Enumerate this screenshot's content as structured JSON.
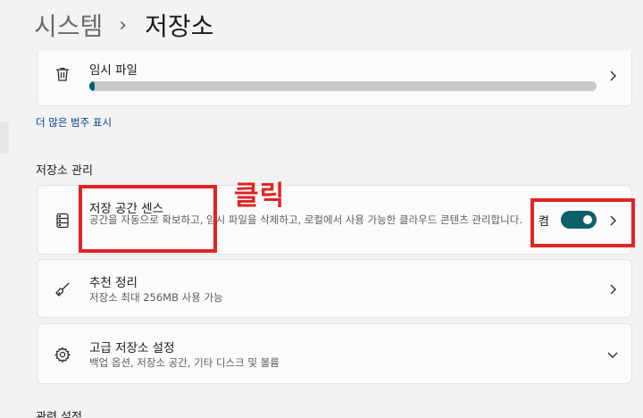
{
  "breadcrumb": {
    "parent": "시스템",
    "separator": "›",
    "current": "저장소"
  },
  "temp_files": {
    "title": "임시 파일",
    "usage_fraction": 0.01
  },
  "show_more_link": "더 많은 범주 표시",
  "management_section": {
    "title": "저장소 관리",
    "storage_sense": {
      "title": "저장 공간 센스",
      "description": "공간을 자동으로 확보하고, 임시 파일을 삭제하고, 로컬에서 사용 가능한 클라우드 콘텐츠 관리합니다.",
      "toggle_label": "켬",
      "toggle_on": true
    },
    "cleanup_recommendations": {
      "title": "추천 정리",
      "description": "저장소 최대 256MB 사용 가능"
    },
    "advanced_settings": {
      "title": "고급 저장소 설정",
      "description": "백업 옵션, 저장소 공간, 기타 디스크 및 볼륨"
    }
  },
  "next_section_title": "관련 설정",
  "annotation": {
    "label": "클릭",
    "color": "#e02424"
  },
  "icons": {
    "temp_files": "trash-icon",
    "storage_sense": "storage-drive-icon",
    "cleanup": "broom-icon",
    "advanced": "gear-icon",
    "chevron_right": "chevron-right-icon",
    "chevron_down": "chevron-down-icon"
  },
  "colors": {
    "accent": "#0f5f6a",
    "link": "#003e92",
    "highlight": "#e02424"
  }
}
